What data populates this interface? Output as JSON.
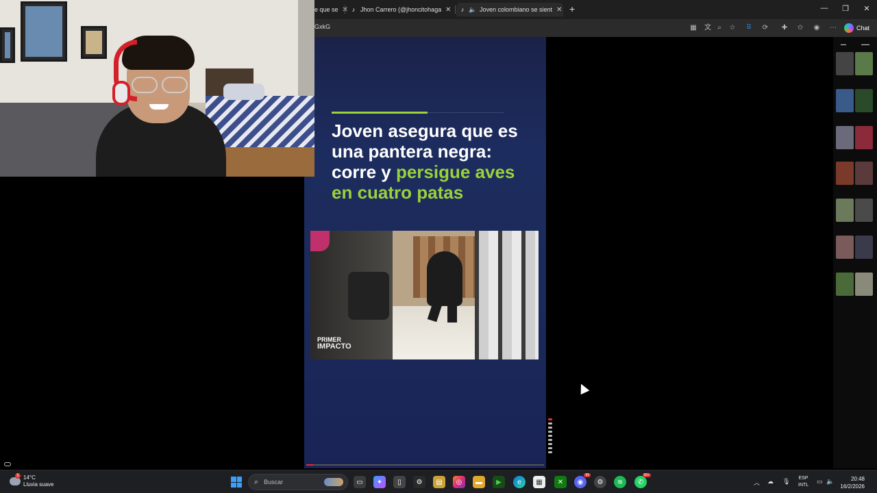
{
  "browser": {
    "tabs": [
      {
        "label": "e que se",
        "icon": "page-icon",
        "active": false
      },
      {
        "label": "Jhon Carrero (@jhoncitohagame …",
        "icon": "tiktok-icon",
        "active": false
      },
      {
        "label": "Joven colombiano se siente c…",
        "icon": "tiktok-icon",
        "active": true
      }
    ],
    "url": "GxkG",
    "chat_label": "Chat"
  },
  "video": {
    "headline_part1": "Joven asegura que es una pantera negra: corre y ",
    "headline_highlight": "persigue aves en cuatro patas",
    "clip_logo_line1": "PRIMER",
    "clip_logo_line2": "IMPACTO"
  },
  "taskbar": {
    "weather_temp": "14°C",
    "weather_desc": "Lluvia suave",
    "weather_badge": "5",
    "search_placeholder": "Buscar",
    "lang_line1": "ESP",
    "lang_line2": "INTL",
    "time": "20:48",
    "date": "16/2/2026",
    "discord_badge": "99",
    "whatsapp_badge": "99+"
  },
  "colors": {
    "accent_green": "#9bd23a",
    "video_bg": "#1d2c5e"
  }
}
